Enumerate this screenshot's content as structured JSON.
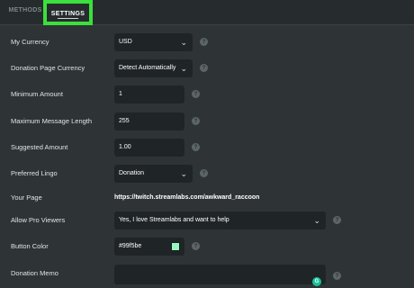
{
  "tabs": {
    "methods": "METHODS",
    "settings": "SETTINGS"
  },
  "settings": [
    {
      "key": "currency",
      "label": "My Currency",
      "value": "USD"
    },
    {
      "key": "page_currency",
      "label": "Donation Page Currency",
      "value": "Detect Automatically"
    },
    {
      "key": "min_amount",
      "label": "Minimum Amount",
      "value": "1"
    },
    {
      "key": "max_msg",
      "label": "Maximum Message Length",
      "value": "255"
    },
    {
      "key": "suggested",
      "label": "Suggested Amount",
      "value": "1.00"
    },
    {
      "key": "lingo",
      "label": "Preferred Lingo",
      "value": "Donation"
    },
    {
      "key": "your_page",
      "label": "Your Page",
      "value": "https://twitch.streamlabs.com/awkward_raccoon"
    },
    {
      "key": "pro_viewers",
      "label": "Allow Pro Viewers",
      "value": "Yes, I love Streamlabs and want to help"
    },
    {
      "key": "button_color",
      "label": "Button Color",
      "value": "#99f5be"
    },
    {
      "key": "memo",
      "label": "Donation Memo",
      "value": ""
    }
  ],
  "icons": {
    "help": "?",
    "dropdown": "chevron-down-icon",
    "grammarly": "G"
  },
  "colors": {
    "background": "#2e3436",
    "field": "#1f2426",
    "highlight": "#3ce03c",
    "button_color_swatch": "#99f5be"
  }
}
